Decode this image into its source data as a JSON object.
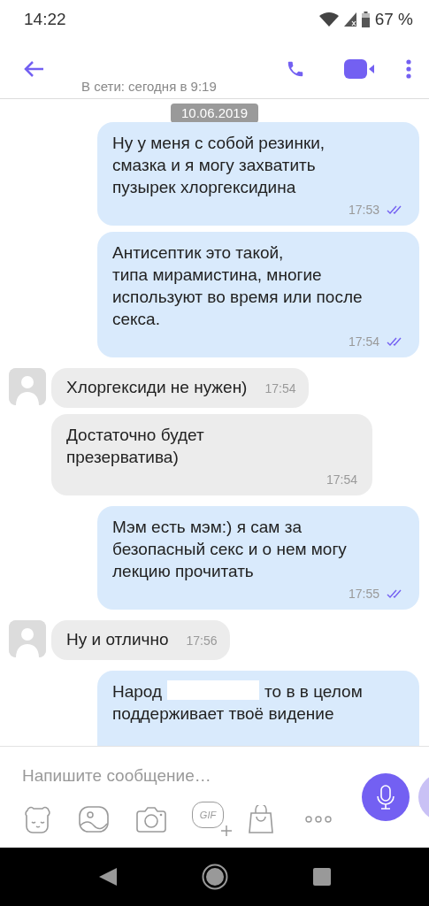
{
  "status_bar": {
    "time": "14:22",
    "battery": "67 %"
  },
  "app_bar": {
    "subtitle": "В сети: сегодня в 9:19"
  },
  "chat": {
    "date": "10.06.2019",
    "messages": [
      {
        "outgoing": true,
        "kind": "stacked",
        "text": "Ну у меня с собой резинки,\nсмазка и я могу захватить\nпузырек хлоргексидина",
        "time": "17:53",
        "read": true
      },
      {
        "outgoing": true,
        "kind": "stacked",
        "text": "Антисептик это такой,\nтипа мирамистина, многие\nиспользуют во время или после\nсекса.",
        "time": "17:54",
        "read": true
      },
      {
        "outgoing": false,
        "kind": "inline",
        "avatar": true,
        "text": "Хлоргексиди не нужен)",
        "time": "17:54"
      },
      {
        "outgoing": false,
        "kind": "stacked",
        "avatar": false,
        "text": "Достаточно будет\nпрезерватива)",
        "time": "17:54"
      },
      {
        "outgoing": true,
        "kind": "stacked",
        "text": "Мэм есть мэм:) я сам за\nбезопасный секс и о нем могу\nлекцию прочитать",
        "time": "17:55",
        "read": true
      },
      {
        "outgoing": false,
        "kind": "inline",
        "avatar": true,
        "text": "Ну и отлично",
        "time": "17:56"
      },
      {
        "outgoing": true,
        "kind": "cut",
        "redacted": true,
        "text": "Народ",
        "text_after": "то в в целом\nподдерживает твоё видение"
      }
    ]
  },
  "composer": {
    "placeholder": "Напишите сообщение…",
    "tools": [
      {
        "kind": "sticker"
      },
      {
        "kind": "gallery"
      },
      {
        "kind": "camera"
      },
      {
        "kind": "gif",
        "label": "GIF"
      },
      {
        "kind": "shop"
      },
      {
        "kind": "more"
      }
    ]
  }
}
